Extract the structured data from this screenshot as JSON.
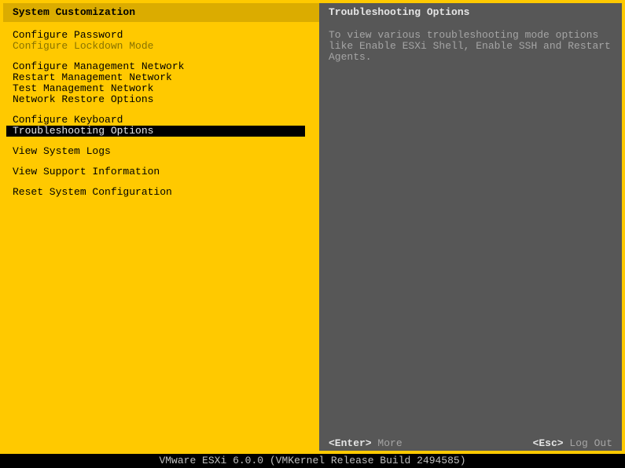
{
  "left": {
    "title": "System Customization",
    "groups": [
      [
        {
          "label": "Configure Password",
          "dimmed": false,
          "selected": false
        },
        {
          "label": "Configure Lockdown Mode",
          "dimmed": true,
          "selected": false
        }
      ],
      [
        {
          "label": "Configure Management Network",
          "dimmed": false,
          "selected": false
        },
        {
          "label": "Restart Management Network",
          "dimmed": false,
          "selected": false
        },
        {
          "label": "Test Management Network",
          "dimmed": false,
          "selected": false
        },
        {
          "label": "Network Restore Options",
          "dimmed": false,
          "selected": false
        }
      ],
      [
        {
          "label": "Configure Keyboard",
          "dimmed": false,
          "selected": false
        },
        {
          "label": "Troubleshooting Options",
          "dimmed": false,
          "selected": true
        }
      ],
      [
        {
          "label": "View System Logs",
          "dimmed": false,
          "selected": false
        }
      ],
      [
        {
          "label": "View Support Information",
          "dimmed": false,
          "selected": false
        }
      ],
      [
        {
          "label": "Reset System Configuration",
          "dimmed": false,
          "selected": false
        }
      ]
    ]
  },
  "right": {
    "title": "Troubleshooting Options",
    "description": "To view various troubleshooting mode options like Enable ESXi Shell, Enable SSH and Restart Agents."
  },
  "footer": {
    "enter_key": "<Enter>",
    "enter_label": "More",
    "esc_key": "<Esc>",
    "esc_label": "Log Out"
  },
  "status_bar": "VMware ESXi 6.0.0 (VMKernel Release Build 2494585)"
}
